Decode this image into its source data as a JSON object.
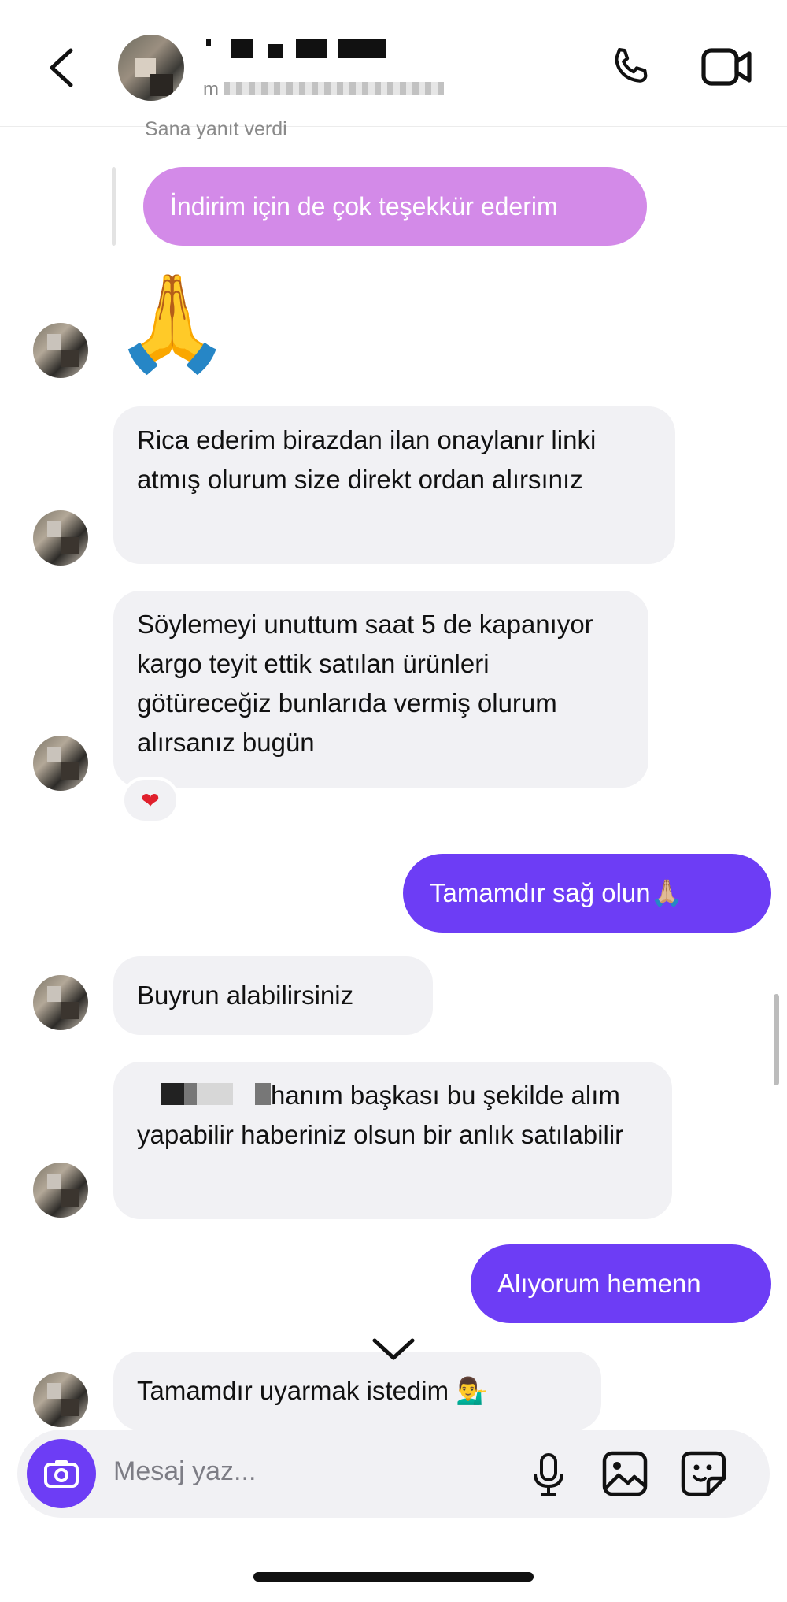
{
  "header": {
    "sub_prefix": "m"
  },
  "thread": {
    "reply_note": "Sana yanıt verdi",
    "reply_quote": "İndirim için de çok teşekkür ederim",
    "emoji_message": "🙏",
    "messages": [
      {
        "side": "in",
        "text": "Rica ederim birazdan ilan onaylanır linki atmış olurum size direkt ordan alırsınız"
      },
      {
        "side": "in",
        "text": "Söylemeyi unuttum saat 5 de kapanıyor kargo teyit ettik satılan ürünleri götüreceğiz bunlarıda vermiş olurum alırsanız bugün",
        "reaction": "❤"
      },
      {
        "side": "out",
        "text": "Tamamdır sağ olun🙏🏼"
      },
      {
        "side": "in",
        "text": "Buyrun alabilirsiniz"
      },
      {
        "side": "in",
        "text": "hanım başkası bu şekilde alım yapabilir haberiniz olsun bir anlık satılabilir"
      },
      {
        "side": "out",
        "text": "Alıyorum hemenn"
      },
      {
        "side": "in",
        "text": "Tamamdır uyarmak istedim 💁‍♂️"
      }
    ]
  },
  "composer": {
    "placeholder": "Mesaj yaz..."
  },
  "colors": {
    "outgoing": "#6d3df5",
    "reply_quote": "#d38ae8",
    "incoming": "#f1f1f4"
  }
}
